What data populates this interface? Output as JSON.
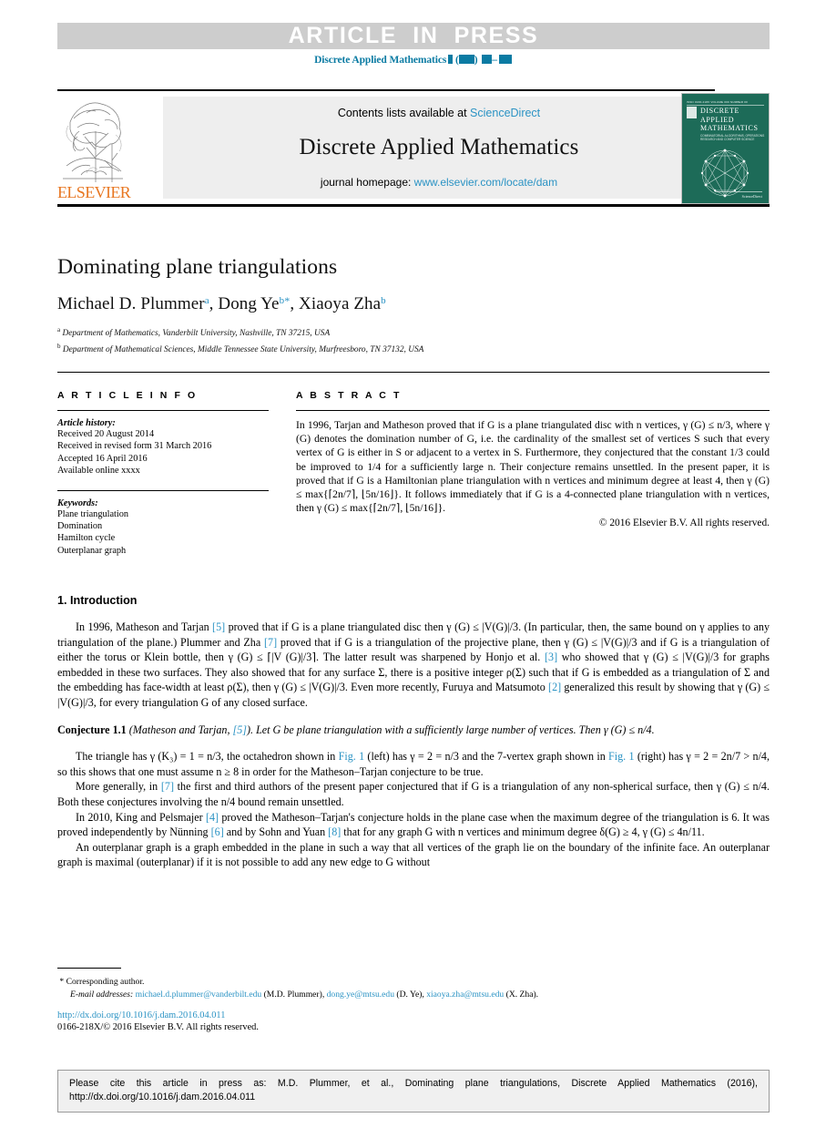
{
  "banner": {
    "press_text": "ARTICLE  IN  PRESS",
    "citation_journal": "Discrete Applied Mathematics",
    "citation_accent": "#0b7ba3"
  },
  "masthead": {
    "contents_prefix": "Contents lists available at ",
    "contents_link": "ScienceDirect",
    "journal_title": "Discrete Applied Mathematics",
    "homepage_prefix": "journal homepage: ",
    "homepage_link": "www.elsevier.com/locate/dam",
    "publisher_wordmark": "ELSEVIER",
    "link_color": "#2b93c4",
    "cover": {
      "topbar": "ISSN 0166-218X   VOLUME 000   NUMBER 00",
      "title_line1": "DISCRETE",
      "title_line2": "APPLIED",
      "title_line3": "MATHEMATICS",
      "subtitle": "COMBINATORIAL ALGORITHMS, OPERATIONS RESEARCH AND COMPUTER SCIENCE",
      "footer": "ScienceDirect",
      "bg_color": "#1d6b58"
    }
  },
  "article": {
    "title": "Dominating plane triangulations",
    "authors": [
      {
        "name": "Michael D. Plummer",
        "mark": "a",
        "corresponding": false
      },
      {
        "name": "Dong Ye",
        "mark": "b",
        "corresponding": true
      },
      {
        "name": "Xiaoya Zha",
        "mark": "b",
        "corresponding": false
      }
    ],
    "affiliations": [
      {
        "mark": "a",
        "text": "Department of Mathematics, Vanderbilt University, Nashville, TN 37215, USA"
      },
      {
        "mark": "b",
        "text": "Department of Mathematical Sciences, Middle Tennessee State University, Murfreesboro, TN 37132, USA"
      }
    ]
  },
  "article_info": {
    "heading": "A R T I C L E   I N F O",
    "history_label": "Article history:",
    "history": [
      "Received 20 August 2014",
      "Received in revised form 31 March 2016",
      "Accepted 16 April 2016",
      "Available online xxxx"
    ],
    "keywords_label": "Keywords:",
    "keywords": [
      "Plane triangulation",
      "Domination",
      "Hamilton cycle",
      "Outerplanar graph"
    ]
  },
  "abstract": {
    "heading": "A B S T R A C T",
    "text": "In 1996, Tarjan and Matheson proved that if G is a plane triangulated disc with n vertices, γ (G) ≤ n/3, where γ (G) denotes the domination number of G, i.e. the cardinality of the smallest set of vertices S such that every vertex of G is either in S or adjacent to a vertex in S. Furthermore, they conjectured that the constant 1/3 could be improved to 1/4 for a sufficiently large n. Their conjecture remains unsettled. In the present paper, it is proved that if G is a Hamiltonian plane triangulation with n vertices and minimum degree at least 4, then γ (G) ≤ max{⌈2n/7⌉, ⌊5n/16⌋}. It follows immediately that if G is a 4-connected plane triangulation with n vertices, then γ (G) ≤ max{⌈2n/7⌉, ⌊5n/16⌋}.",
    "copyright": "© 2016 Elsevier B.V. All rights reserved."
  },
  "introduction": {
    "section_number": "1.",
    "section_title": "Introduction",
    "paragraph_1": "In 1996, Matheson and Tarjan [5] proved that if G is a plane triangulated disc then γ (G) ≤ |V(G)|/3. (In particular, then, the same bound on γ applies to any triangulation of the plane.) Plummer and Zha [7] proved that if G is a triangulation of the projective plane, then γ (G) ≤ |V(G)|/3 and if G is a triangulation of either the torus or Klein bottle, then γ (G) ≤ ⌈|V (G)|/3⌉. The latter result was sharpened by Honjo et al. [3] who showed that γ (G) ≤ |V(G)|/3 for graphs embedded in these two surfaces. They also showed that for any surface Σ, there is a positive integer ρ(Σ) such that if G is embedded as a triangulation of Σ and the embedding has face-width at least ρ(Σ), then γ (G) ≤ |V(G)|/3. Even more recently, Furuya and Matsumoto [2] generalized this result by showing that γ (G) ≤ |V(G)|/3, for every triangulation G of any closed surface.",
    "conjecture_label": "Conjecture 1.1",
    "conjecture_source": "(Matheson and Tarjan, [5]).",
    "conjecture_text": "Let G be plane triangulation with a sufficiently large number of vertices. Then γ (G) ≤ n/4.",
    "paragraph_2": "The triangle has γ (K₃) = 1 = n/3, the octahedron shown in Fig. 1 (left) has γ = 2 = n/3 and the 7-vertex graph shown in Fig. 1 (right) has γ = 2 = 2n/7 > n/4, so this shows that one must assume n ≥ 8 in order for the Matheson–Tarjan conjecture to be true.",
    "paragraph_3": "More generally, in [7] the first and third authors of the present paper conjectured that if G is a triangulation of any non-spherical surface, then γ (G) ≤ n/4. Both these conjectures involving the n/4 bound remain unsettled.",
    "paragraph_4": "In 2010, King and Pelsmajer [4] proved the Matheson–Tarjan's conjecture holds in the plane case when the maximum degree of the triangulation is 6. It was proved independently by Nünning [6] and by Sohn and Yuan [8] that for any graph G with n vertices and minimum degree δ(G) ≥ 4, γ (G) ≤ 4n/11.",
    "paragraph_5": "An outerplanar graph is a graph embedded in the plane in such a way that all vertices of the graph lie on the boundary of the infinite face. An outerplanar graph is maximal (outerplanar) if it is not possible to add any new edge to G without",
    "ref_color": "#2b93c4"
  },
  "footnote": {
    "corresponding_marker": "*",
    "corresponding_text": "Corresponding author.",
    "email_label": "E-mail addresses:",
    "emails": [
      {
        "address": "michael.d.plummer@vanderbilt.edu",
        "owner": "(M.D. Plummer)"
      },
      {
        "address": "dong.ye@mtsu.edu",
        "owner": "(D. Ye)"
      },
      {
        "address": "xiaoya.zha@mtsu.edu",
        "owner": "(X. Zha)"
      }
    ],
    "doi": "http://dx.doi.org/10.1016/j.dam.2016.04.011",
    "issn_line": "0166-218X/© 2016 Elsevier B.V. All rights reserved."
  },
  "citation_box": {
    "line1": "Please cite this article in press as: M.D. Plummer, et al., Dominating plane triangulations, Discrete Applied Mathematics (2016),",
    "line2": "http://dx.doi.org/10.1016/j.dam.2016.04.011"
  }
}
